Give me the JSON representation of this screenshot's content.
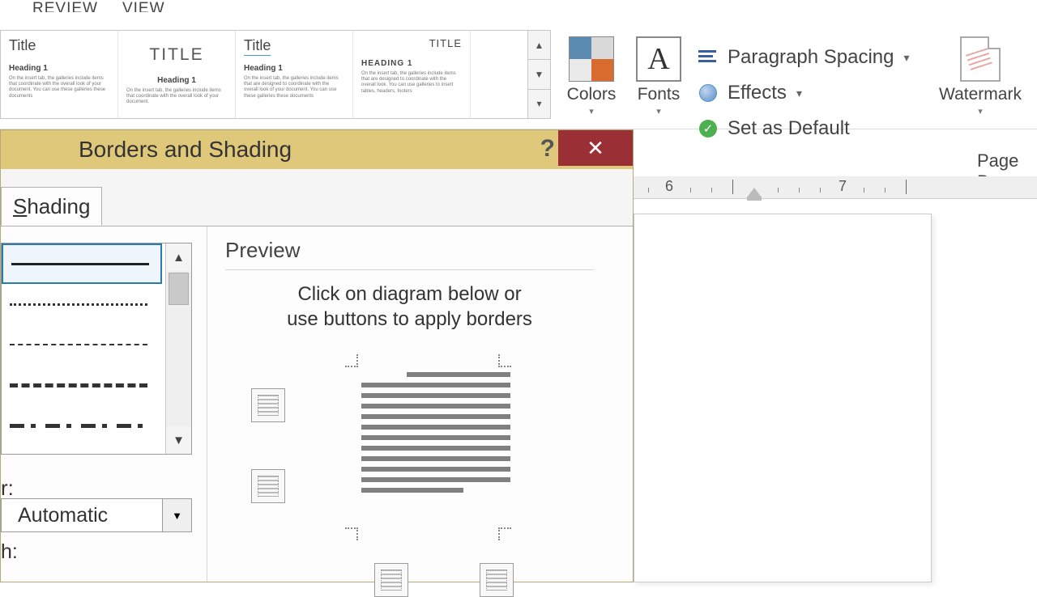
{
  "ribbon_tabs": {
    "review": "REVIEW",
    "view": "VIEW"
  },
  "gallery": {
    "items": [
      {
        "title": "Title",
        "heading": "Heading 1",
        "body": "On the insert tab, the galleries include items that coordinate with the overall look of your document. You can use these galleries these documents"
      },
      {
        "title": "TITLE",
        "heading": "Heading 1",
        "body": "On the insert tab, the galleries include items that coordinate with the overall look of your document."
      },
      {
        "title": "Title",
        "heading": "Heading 1",
        "body": "On the insert tab, the galleries include items that are designed to coordinate with the overall look of your document. You can use these galleries these documents"
      },
      {
        "title": "TITLE",
        "heading": "HEADING 1",
        "body": "On the insert tab, the galleries include items that are designed to coordinate with the overall look. You can use galleries to insert tables, headers, footers"
      }
    ]
  },
  "groups": {
    "colors": "Colors",
    "fonts": "Fonts",
    "paragraph_spacing": "Paragraph Spacing",
    "effects": "Effects",
    "set_as_default": "Set as Default",
    "watermark": "Watermark",
    "page_ba": "Page Ba"
  },
  "dialog": {
    "title": "Borders and Shading",
    "tabs": {
      "shading": "hading",
      "shading_u": "S"
    },
    "color_label": "r:",
    "color_value": "Automatic",
    "width_label": "h:",
    "preview": {
      "title": "Preview",
      "instruction_l1": "Click on diagram below or",
      "instruction_l2": "use buttons to apply borders"
    }
  },
  "ruler": {
    "n6": "6",
    "n7": "7"
  },
  "dropdown_arrow": "▾",
  "up_arrow": "▲",
  "down_arrow": "▼",
  "close_x": "✕",
  "help_q": "?",
  "check": "✓",
  "fonts_glyph": "A"
}
